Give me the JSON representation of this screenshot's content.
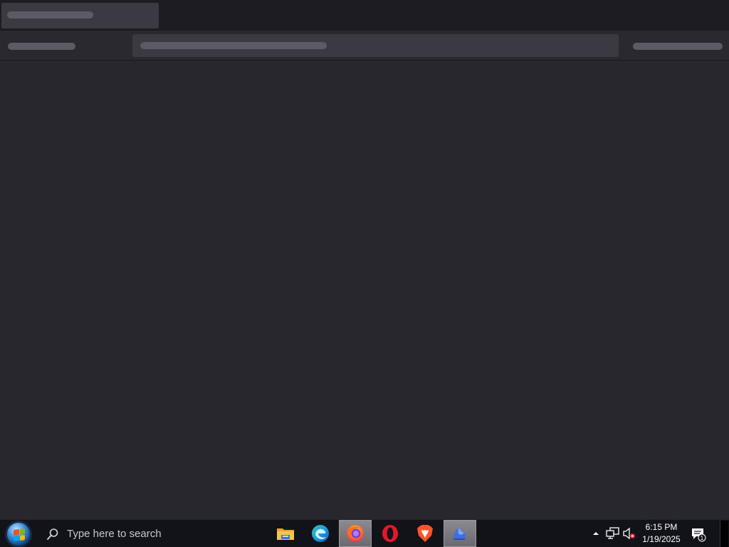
{
  "browser": {
    "state": "loading-skeleton"
  },
  "taskbar": {
    "search_placeholder": "Type here to search",
    "pinned_apps": [
      {
        "name": "File Explorer",
        "icon": "folder-icon",
        "active": false
      },
      {
        "name": "Microsoft Edge",
        "icon": "edge-icon",
        "active": false
      },
      {
        "name": "Firefox",
        "icon": "firefox-icon",
        "active": true
      },
      {
        "name": "Opera",
        "icon": "opera-icon",
        "active": false
      },
      {
        "name": "Brave",
        "icon": "brave-icon",
        "active": false
      },
      {
        "name": "App",
        "icon": "blue-app-icon",
        "active": true
      }
    ],
    "tray": {
      "icons": [
        "chevron-up-icon",
        "network-icon",
        "volume-muted-icon"
      ],
      "time": "6:15 PM",
      "date": "1/19/2025",
      "notification_count": "1"
    }
  },
  "colors": {
    "page_background": "#28272e",
    "tabstrip": "#1d1c22",
    "skeleton_bar": "#5c5b63",
    "urlbar": "#3b3a42",
    "taskbar": "#121219"
  }
}
